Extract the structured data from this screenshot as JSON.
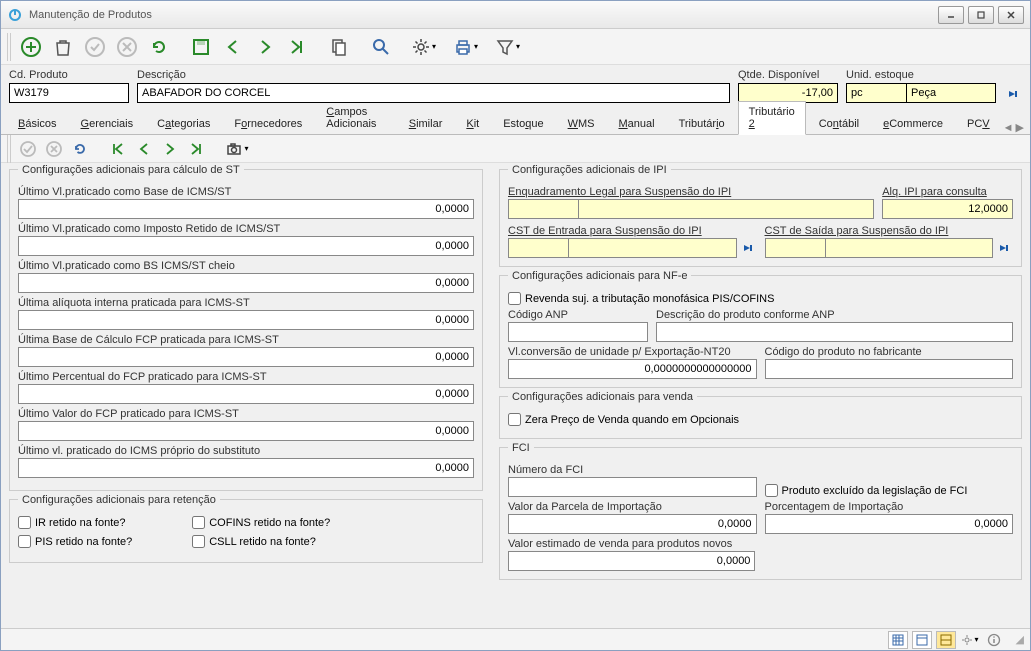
{
  "window": {
    "title": "Manutenção de Produtos"
  },
  "top": {
    "cd_produto_label": "Cd. Produto",
    "cd_produto": "W3179",
    "descricao_label": "Descrição",
    "descricao": "ABAFADOR DO CORCEL",
    "qtde_label": "Qtde. Disponível",
    "qtde": "-17,00",
    "unid_label": "Unid. estoque",
    "unid_code": "pc",
    "unid_desc": "Peça"
  },
  "tabs": {
    "items": [
      "Básicos",
      "Gerenciais",
      "Categorias",
      "Fornecedores",
      "Campos Adicionais",
      "Similar",
      "Kit",
      "Estoque",
      "WMS",
      "Manual",
      "Tributário",
      "Tributário 2",
      "Contábil",
      "eCommerce",
      "PCV"
    ],
    "active": "Tributário 2"
  },
  "st_group": {
    "title": "Configurações adicionais para cálculo de ST",
    "rows": [
      {
        "label": "Último Vl.praticado como Base de ICMS/ST",
        "value": "0,0000"
      },
      {
        "label": "Último Vl.praticado como Imposto Retido de ICMS/ST",
        "value": "0,0000"
      },
      {
        "label": "Último Vl.praticado como BS ICMS/ST cheio",
        "value": "0,0000"
      },
      {
        "label": "Última alíquota interna praticada para ICMS-ST",
        "value": "0,0000"
      },
      {
        "label": "Última Base de Cálculo FCP praticada para ICMS-ST",
        "value": "0,0000"
      },
      {
        "label": "Último Percentual do FCP praticado para ICMS-ST",
        "value": "0,0000"
      },
      {
        "label": "Último Valor do FCP praticado para ICMS-ST",
        "value": "0,0000"
      },
      {
        "label": "Último vl. praticado do ICMS próprio do substituto",
        "value": "0,0000"
      }
    ]
  },
  "retencao_group": {
    "title": "Configurações adicionais para retenção",
    "checks_left": [
      "IR retido na fonte?",
      "PIS retido na fonte?"
    ],
    "checks_right": [
      "COFINS retido na fonte?",
      "CSLL retido na fonte?"
    ]
  },
  "ipi_group": {
    "title": "Configurações adicionais de IPI",
    "enq_label": "Enquadramento Legal para Suspensão do IPI",
    "alq_label": "Alq. IPI para consulta",
    "alq_value": "12,0000",
    "cst_entrada_label": "CST de Entrada para Suspensão do IPI",
    "cst_saida_label": "CST de Saída para Suspensão do IPI"
  },
  "nfe_group": {
    "title": "Configurações adicionais para NF-e",
    "chk_revenda": "Revenda suj. a tributação monofásica PIS/COFINS",
    "cod_anp_label": "Código ANP",
    "desc_anp_label": "Descrição do produto conforme ANP",
    "conv_label": "Vl.conversão de unidade p/ Exportação-NT20",
    "conv_value": "0,0000000000000000",
    "cod_fab_label": "Código do produto no fabricante"
  },
  "venda_group": {
    "title": "Configurações adicionais para venda",
    "chk_zera": "Zera Preço de Venda quando em Opcionais"
  },
  "fci_group": {
    "title": "FCI",
    "num_label": "Número da FCI",
    "chk_excl": "Produto excluído da legislação de FCI",
    "parc_label": "Valor da Parcela de Importação",
    "parc_value": "0,0000",
    "porc_label": "Porcentagem de Importação",
    "porc_value": "0,0000",
    "est_label": "Valor estimado de venda para produtos novos",
    "est_value": "0,0000"
  }
}
